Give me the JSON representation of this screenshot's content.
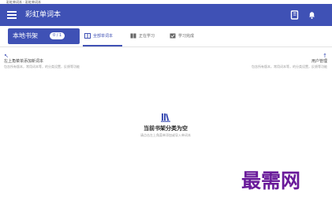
{
  "window": {
    "title": "彩虹单词本 - 彩虹单词本"
  },
  "appbar": {
    "title": "彩虹单词本",
    "menu_icon": "menu-icon",
    "actions": [
      "book-icon",
      "bell-icon"
    ]
  },
  "bookshelf": {
    "label": "本地书架",
    "badge": "0 / 1"
  },
  "tabs": [
    {
      "label": "全部单词本",
      "icon": "book-open-icon",
      "active": true
    },
    {
      "label": "正在学习",
      "icon": "book-icon",
      "active": false
    },
    {
      "label": "学习完成",
      "icon": "book-check-icon",
      "active": false
    }
  ],
  "hint_left": {
    "arrow": "↖",
    "title": "左上角菜单添加新词本",
    "subtitle": "包含所有版本，常用词本等，的分类设置，反馈等功能"
  },
  "hint_right": {
    "arrow": "↑",
    "title": "用户管理",
    "subtitle": "包含所有版本，常用词本等，的分类设置，反馈等功能"
  },
  "empty_state": {
    "icon": "library-icon",
    "title": "当前书架分类为空",
    "subtitle": "请点击左上角菜单添加或导入单词本"
  },
  "watermark": {
    "text": "最需网"
  },
  "colors": {
    "primary": "#3f51b5",
    "watermark": "#6a1b9a"
  }
}
